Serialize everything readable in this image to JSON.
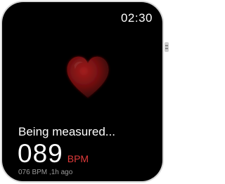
{
  "clock": "02:30",
  "status": "Being measured...",
  "heart_rate": {
    "value": "089",
    "unit": "BPM",
    "unit_color": "#e03a3a"
  },
  "last_measurement": "076 BPM ,1h ago",
  "icons": {
    "heart": "heart-icon"
  }
}
